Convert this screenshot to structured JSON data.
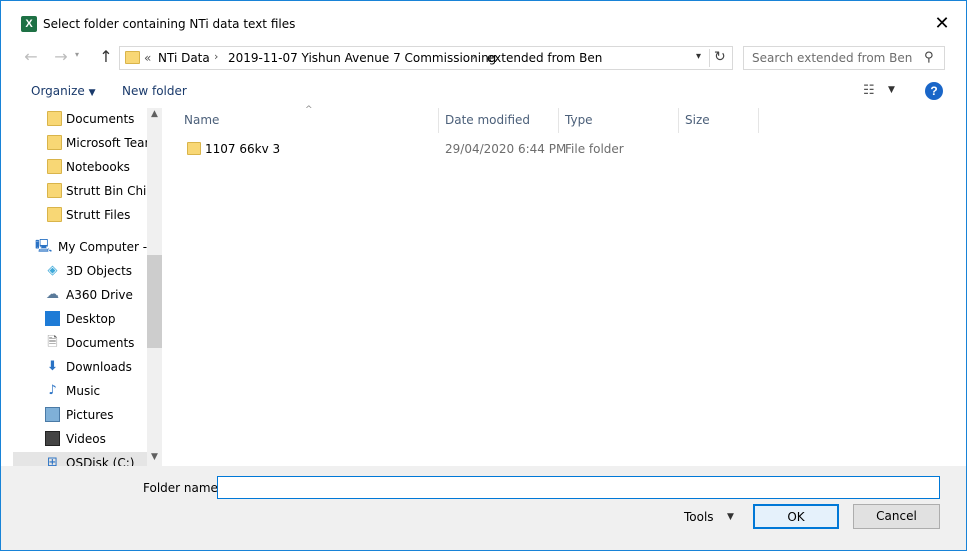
{
  "window": {
    "title": "Select folder containing NTi data text files",
    "app_icon": "excel-icon",
    "close_glyph": "✕"
  },
  "address": {
    "history_glyph": "«",
    "crumbs": [
      "NTi Data",
      "2019-11-07 Yishun Avenue 7 Commissioning",
      "extended from Ben"
    ],
    "separator": "›"
  },
  "search": {
    "placeholder": "Search extended from Ben"
  },
  "toolbar": {
    "organize_label": "Organize",
    "new_folder_label": "New folder",
    "help_label": "?"
  },
  "navpane": {
    "quick_items": [
      {
        "label": "Documents",
        "icon": "folder-icon"
      },
      {
        "label": "Microsoft Teams",
        "icon": "folder-icon"
      },
      {
        "label": "Notebooks",
        "icon": "folder-icon"
      },
      {
        "label": "Strutt Bin Chicken",
        "icon": "folder-icon"
      },
      {
        "label": "Strutt Files",
        "icon": "folder-icon"
      }
    ],
    "computer_label": "My Computer - Strutt",
    "computer_items": [
      {
        "label": "3D Objects",
        "icon": "cube-icon"
      },
      {
        "label": "A360 Drive",
        "icon": "cloud-drive-icon"
      },
      {
        "label": "Desktop",
        "icon": "desktop-icon"
      },
      {
        "label": "Documents",
        "icon": "documents-icon"
      },
      {
        "label": "Downloads",
        "icon": "download-arrow-icon"
      },
      {
        "label": "Music",
        "icon": "music-note-icon"
      },
      {
        "label": "Pictures",
        "icon": "pictures-icon"
      },
      {
        "label": "Videos",
        "icon": "film-icon"
      },
      {
        "label": "OSDisk (C:)",
        "icon": "disk-icon"
      }
    ]
  },
  "filelist": {
    "columns": {
      "name": "Name",
      "date": "Date modified",
      "type": "Type",
      "size": "Size"
    },
    "rows": [
      {
        "name": "1107 66kv 3",
        "date": "29/04/2020 6:44 PM",
        "type": "File folder",
        "size": ""
      }
    ]
  },
  "bottom": {
    "folder_name_label": "Folder name:",
    "folder_name_value": "",
    "tools_label": "Tools",
    "ok_label": "OK",
    "cancel_label": "Cancel"
  },
  "colors": {
    "accent": "#0078d7",
    "folder": "#f8d775",
    "help": "#1a66c8"
  }
}
